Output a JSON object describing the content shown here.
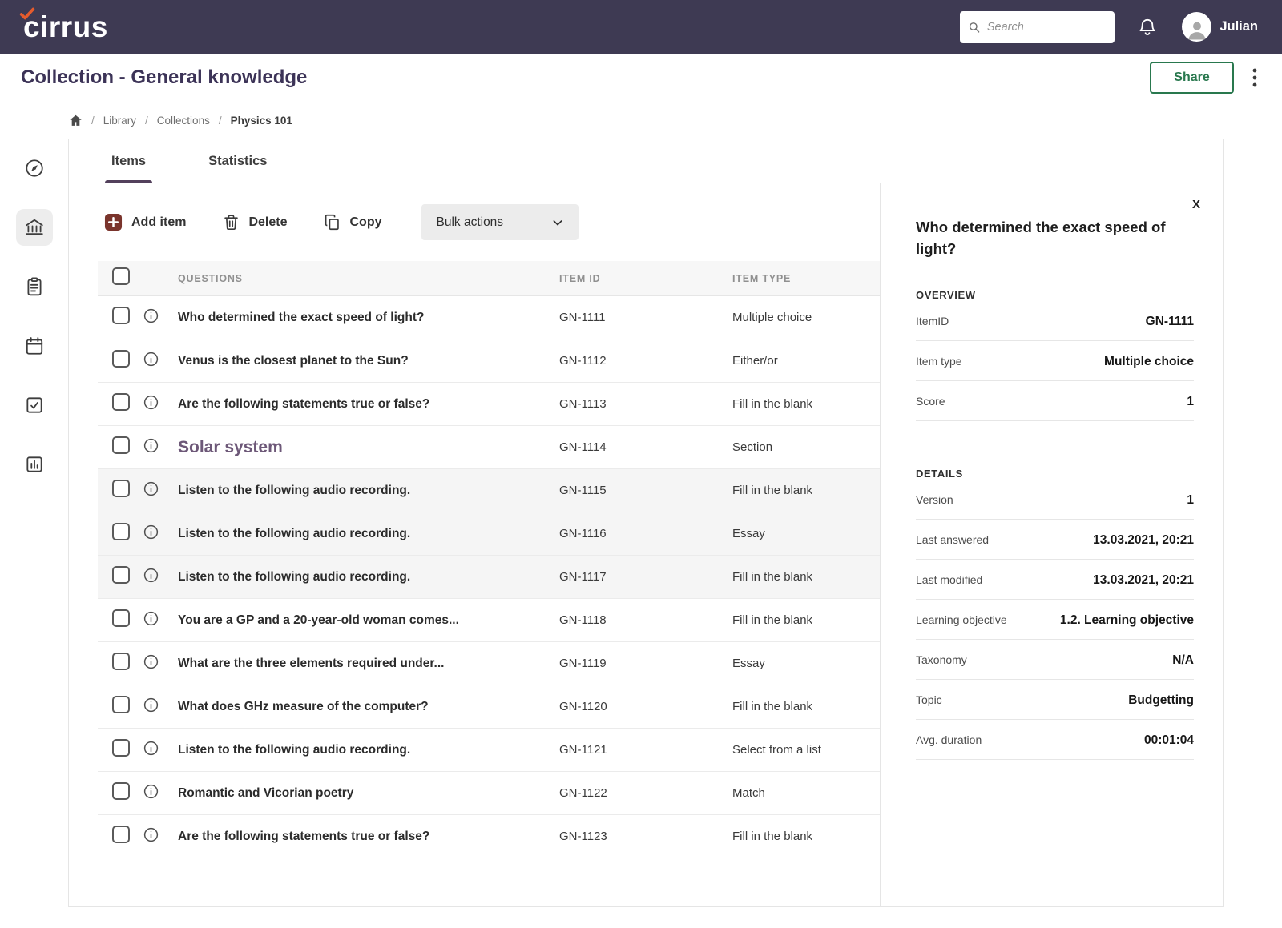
{
  "topbar": {
    "logo": "cirrus",
    "search": {
      "placeholder": "Search"
    },
    "user": {
      "name": "Julian"
    }
  },
  "header": {
    "title": "Collection - General knowledge",
    "share_label": "Share"
  },
  "breadcrumb": {
    "separator": "/",
    "items": [
      "Library",
      "Collections",
      "Physics 101"
    ]
  },
  "sidebar": {
    "items": [
      {
        "name": "compass",
        "active": false
      },
      {
        "name": "collections",
        "active": true
      },
      {
        "name": "assessments",
        "active": false
      },
      {
        "name": "schedule",
        "active": false
      },
      {
        "name": "marking",
        "active": false
      },
      {
        "name": "reports",
        "active": false
      }
    ]
  },
  "tabs": [
    {
      "label": "Items",
      "active": true
    },
    {
      "label": "Statistics",
      "active": false
    }
  ],
  "toolbar": {
    "add_item_label": "Add item",
    "delete_label": "Delete",
    "copy_label": "Copy",
    "bulk_actions_label": "Bulk actions"
  },
  "table": {
    "headers": {
      "questions": "QUESTIONS",
      "item_id": "ITEM ID",
      "item_type": "ITEM TYPE"
    },
    "rows": [
      {
        "question": "Who determined the exact speed of light?",
        "id": "GN-1111",
        "type": "Multiple choice",
        "section": false,
        "shaded": false
      },
      {
        "question": "Venus is the closest planet to the Sun?",
        "id": "GN-1112",
        "type": "Either/or",
        "section": false,
        "shaded": false
      },
      {
        "question": "Are the following statements true or false?",
        "id": "GN-1113",
        "type": "Fill in the blank",
        "section": false,
        "shaded": false
      },
      {
        "question": "Solar system",
        "id": "GN-1114",
        "type": "Section",
        "section": true,
        "shaded": false
      },
      {
        "question": "Listen to the following audio recording.",
        "id": "GN-1115",
        "type": "Fill in the blank",
        "section": false,
        "shaded": true
      },
      {
        "question": "Listen to the following audio recording.",
        "id": "GN-1116",
        "type": "Essay",
        "section": false,
        "shaded": true
      },
      {
        "question": "Listen to the following audio recording.",
        "id": "GN-1117",
        "type": "Fill in the blank",
        "section": false,
        "shaded": true
      },
      {
        "question": "You are a GP and a 20-year-old woman comes...",
        "id": "GN-1118",
        "type": "Fill in the blank",
        "section": false,
        "shaded": false
      },
      {
        "question": "What are the three elements required under...",
        "id": "GN-1119",
        "type": "Essay",
        "section": false,
        "shaded": false
      },
      {
        "question": "What does GHz measure of the computer?",
        "id": "GN-1120",
        "type": "Fill in the blank",
        "section": false,
        "shaded": false
      },
      {
        "question": "Listen to the following audio recording.",
        "id": "GN-1121",
        "type": "Select from a list",
        "section": false,
        "shaded": false
      },
      {
        "question": "Romantic and Vicorian poetry",
        "id": "GN-1122",
        "type": "Match",
        "section": false,
        "shaded": false
      },
      {
        "question": "Are the following statements true or false?",
        "id": "GN-1123",
        "type": "Fill in the blank",
        "section": false,
        "shaded": false
      }
    ]
  },
  "details_panel": {
    "close_label": "X",
    "title": "Who determined the exact speed of light?",
    "overview_heading": "OVERVIEW",
    "overview": [
      {
        "label": "ItemID",
        "value": "GN-1111"
      },
      {
        "label": "Item type",
        "value": "Multiple choice"
      },
      {
        "label": "Score",
        "value": "1"
      }
    ],
    "details_heading": "DETAILS",
    "details": [
      {
        "label": "Version",
        "value": "1"
      },
      {
        "label": "Last answered",
        "value": "13.03.2021, 20:21"
      },
      {
        "label": "Last modified",
        "value": "13.03.2021, 20:21"
      },
      {
        "label": "Learning objective",
        "value": "1.2. Learning objective"
      },
      {
        "label": "Taxonomy",
        "value": "N/A"
      },
      {
        "label": "Topic",
        "value": "Budgetting"
      },
      {
        "label": "Avg. duration",
        "value": "00:01:04"
      }
    ]
  },
  "colors": {
    "topbar_bg": "#3e3a53",
    "accent_purple": "#53405c",
    "share_green": "#29784e",
    "add_item_red": "#7a342c",
    "logo_check_orange": "#e55b2d"
  }
}
